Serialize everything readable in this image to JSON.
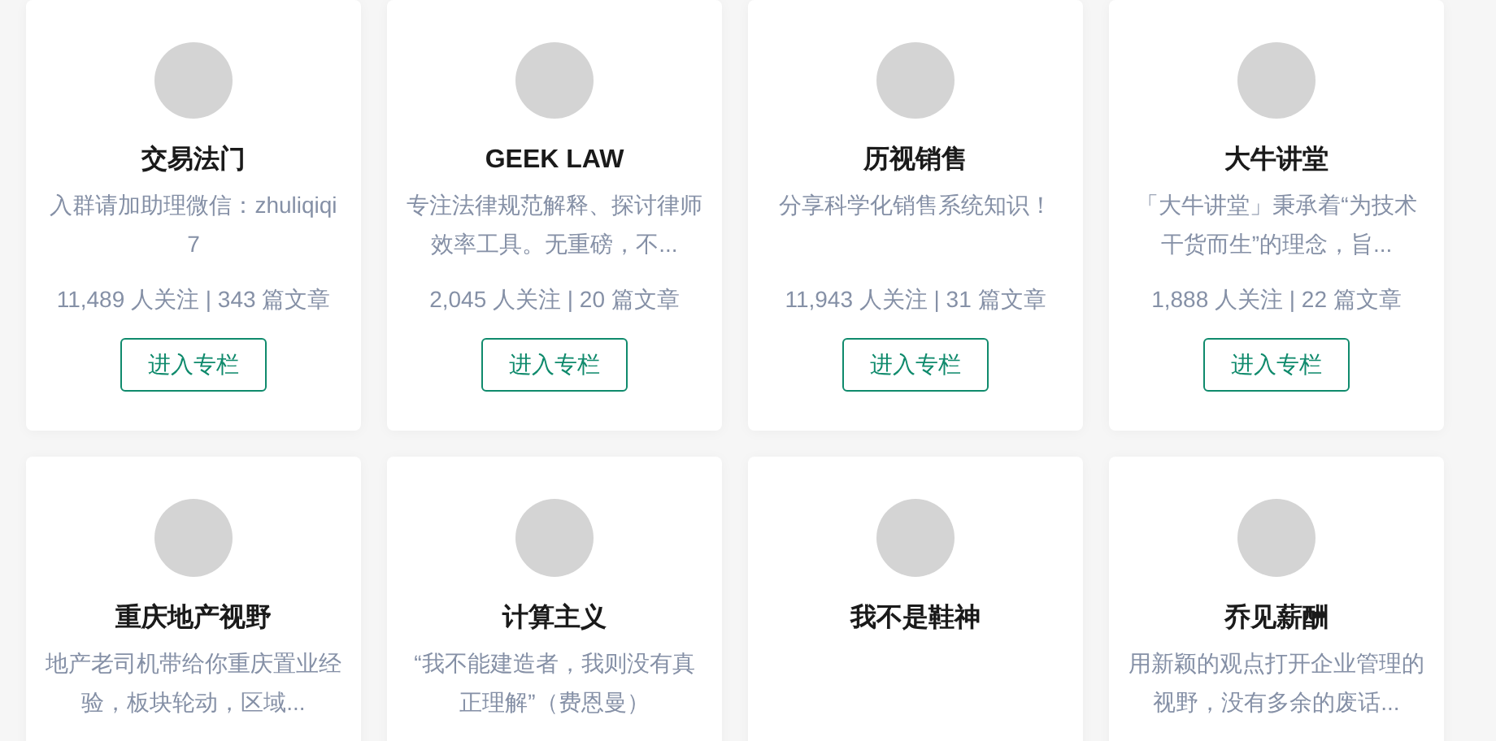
{
  "columns": [
    {
      "title": "交易法门",
      "description": "入群请加助理微信：zhuliqiqi7",
      "stats": "11,489 人关注 | 343 篇文章",
      "button": "进入专栏"
    },
    {
      "title": "GEEK LAW",
      "description": "专注法律规范解释、探讨律师效率工具。无重磅，不...",
      "stats": "2,045 人关注 | 20 篇文章",
      "button": "进入专栏"
    },
    {
      "title": "历视销售",
      "description": "分享科学化销售系统知识！",
      "stats": "11,943 人关注 | 31 篇文章",
      "button": "进入专栏"
    },
    {
      "title": "大牛讲堂",
      "description": "「大牛讲堂」秉承着“为技术干货而生”的理念，旨...",
      "stats": "1,888 人关注 | 22 篇文章",
      "button": "进入专栏"
    },
    {
      "title": "重庆地产视野",
      "description": "地产老司机带给你重庆置业经验，板块轮动，区域..."
    },
    {
      "title": "计算主义",
      "description": "“我不能建造者，我则没有真正理解”（费恩曼）"
    },
    {
      "title": "我不是鞋神"
    },
    {
      "title": "乔见薪酬",
      "description": "用新颖的观点打开企业管理的视野，没有多余的废话..."
    }
  ]
}
